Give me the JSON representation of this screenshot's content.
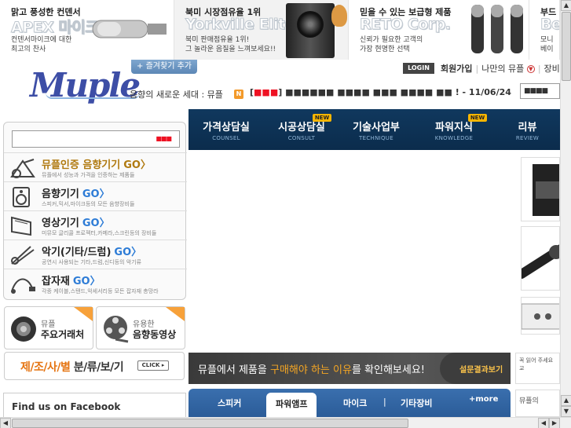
{
  "banners": [
    {
      "title": "맑고 풍성한 컨덴서",
      "big": "APEX 마이크",
      "desc1": "컨덴서마이크에 대한",
      "desc2": "최고의 찬사"
    },
    {
      "title": "북미 시장점유율 1위",
      "big": "Yorkville Elite",
      "desc1": "북미 판매점유율 1위!",
      "desc2": "그 놀라운 음질을 느껴보세요!!"
    },
    {
      "title": "믿을 수 있는 보급형 제품",
      "big": "RETO Corp.",
      "desc1": "신뢰가 필요한 고객의",
      "desc2": "가장 현명한 선택"
    },
    {
      "title": "부드",
      "big": "Be",
      "desc1": "모니",
      "desc2": "베이"
    }
  ],
  "header": {
    "fav_label": "+ 즐겨찾기 추가",
    "logo": "Muple",
    "tagline": "음향의 새로운 세대 : 뮤플",
    "rss": "N",
    "ticker_prefix": "[",
    "ticker_red": "■■■",
    "ticker_mid": "]",
    "ticker_text": " ■■■■■■ ■■■■ ■■■ ■■■■ ■■ ! - 11/06/24",
    "login": "LOGIN",
    "signup": "회원가입",
    "my_muple": "나만의 뮤플",
    "equipment": "장비가",
    "search_value": "■■■■"
  },
  "nav": [
    {
      "main": "가격상담실",
      "sub": "COUNSEL",
      "new": ""
    },
    {
      "main": "시공상담실",
      "sub": "CONSULT",
      "new": "NEW"
    },
    {
      "main": "기술사업부",
      "sub": "TECHNIQUE",
      "new": ""
    },
    {
      "main": "파워지식",
      "sub": "KNOWLEDGE",
      "new": "NEW"
    },
    {
      "main": "리뷰",
      "sub": "REVIEW",
      "new": ""
    }
  ],
  "left": {
    "search_value": "■■■",
    "categories": [
      {
        "title": "뮤플인증 음향기기",
        "go": "GO〉",
        "desc": "뮤플에서 성능과 가격을 인증하는 제품들"
      },
      {
        "title": "음향기기",
        "go": "GO〉",
        "desc": "스피커,믹서,마이크등의 모든 음향장비들"
      },
      {
        "title": "영상기기",
        "go": "GO〉",
        "desc": "미뮤모 글리콜 프로젝터,카메라,스크린등의 장비들"
      },
      {
        "title": "악기(기타/드럼)",
        "go": "GO〉",
        "desc": "공연시 사용되는 기타,드럼,신디등의 악기류"
      },
      {
        "title": "잡자재",
        "go": "GO〉",
        "desc": "각종 케이블,스탠드,악세서리등 모든 잡자재 총망라"
      }
    ],
    "quick": [
      {
        "small": "뮤플",
        "large": "주요거래처"
      },
      {
        "small": "유용한",
        "large": "음향동영상"
      }
    ],
    "maker": {
      "orange": "제/조/사/별",
      "dark": " 분/류/보/기",
      "click": "CLICK ▸"
    },
    "facebook": "Find us on Facebook"
  },
  "main": {
    "promo": {
      "pre": "뮤플에서 제품을 ",
      "hl": "구매해야 하는 이유",
      "post": "를 확인해보세요!",
      "cta": "설문결과보기"
    },
    "tabs": [
      "스피커",
      "파워앰프",
      "마이크",
      "기타장비"
    ],
    "tab_sep": "|",
    "more": "+more"
  },
  "right": {
    "note": "꼭 읽어 주세요 교",
    "note2": "뮤플의"
  },
  "scroll": {
    "up": "▲",
    "down": "▼",
    "left": "◀",
    "right": "▶"
  }
}
